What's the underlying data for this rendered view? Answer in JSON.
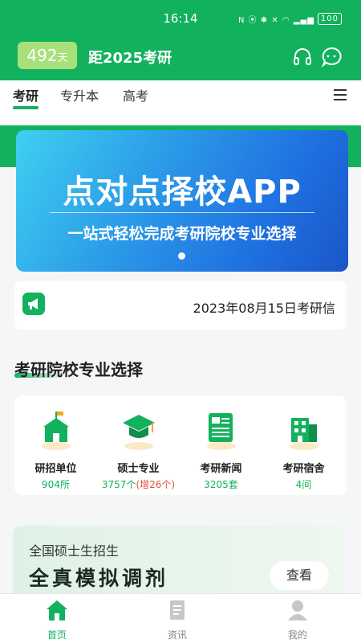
{
  "status_bar": {
    "time": "16:14",
    "icons_text": "N ⦿ ✱ ✕ ◠ ▂▄▆",
    "battery": "100"
  },
  "header": {
    "days_number": "492",
    "days_unit": "天",
    "countdown": "距2025考研",
    "icons": [
      "headset-icon",
      "chat-icon"
    ]
  },
  "tabs": [
    {
      "label": "考研",
      "active": true
    },
    {
      "label": "专升本",
      "active": false
    },
    {
      "label": "高考",
      "active": false
    }
  ],
  "banner": {
    "title": "点对点择校APP",
    "subtitle": "一站式轻松完成考研院校专业选择"
  },
  "notice": {
    "text": "2023年08月15日考研信"
  },
  "section": {
    "title": "考研院校专业选择"
  },
  "categories": [
    {
      "label": "研招单位",
      "count": "904所",
      "icon": "school-icon"
    },
    {
      "label": "硕士专业",
      "count": "3757个",
      "count_extra": "(增26个)",
      "icon": "graduation-cap-icon"
    },
    {
      "label": "考研新闻",
      "count": "3205套",
      "icon": "news-icon"
    },
    {
      "label": "考研宿舍",
      "count": "4间",
      "icon": "dormitory-icon"
    }
  ],
  "promo": {
    "subtitle": "全国硕士生招生",
    "title": "全真模拟调剂",
    "button": "查看"
  },
  "bottom_nav": [
    {
      "label": "首页",
      "icon": "home-icon",
      "active": true
    },
    {
      "label": "资讯",
      "icon": "news-doc-icon",
      "active": false
    },
    {
      "label": "我的",
      "icon": "profile-icon",
      "active": false
    }
  ],
  "colors": {
    "brand_green": "#12b15d",
    "badge_green": "#a8e07a",
    "highlight_red": "#e2533d"
  }
}
